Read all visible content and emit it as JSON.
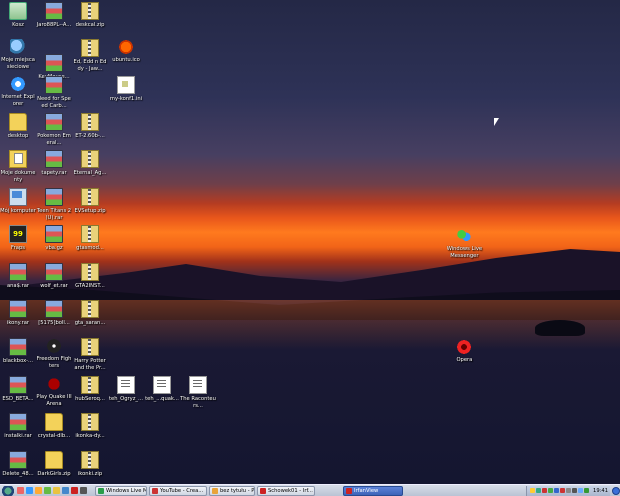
{
  "desktop": {
    "icons": [
      {
        "label": "Kosz",
        "type": "recycle"
      },
      {
        "label": "Moje miejsca sieciowe",
        "type": "network"
      },
      {
        "label": "Internet Explorer",
        "type": "ie"
      },
      {
        "label": "desktop",
        "type": "folder"
      },
      {
        "label": "Moje dokumenty",
        "type": "mydocs"
      },
      {
        "label": "Mój komputer",
        "type": "computer"
      },
      {
        "label": "Fraps",
        "type": "fraps"
      },
      {
        "label": "ana$.rar",
        "type": "rar"
      },
      {
        "label": "ikony.rar",
        "type": "rar"
      },
      {
        "label": "blackbox-...",
        "type": "rar"
      },
      {
        "label": "ESD_BETA...",
        "type": "rar"
      },
      {
        "label": "instalki.rar",
        "type": "rar"
      },
      {
        "label": "Delete_48...",
        "type": "rar"
      },
      {
        "label": "Jaro88PL--A...",
        "type": "rar"
      },
      {
        "label": "KeyMouse...",
        "type": "rar"
      },
      {
        "label": "Need for Speed Carb...",
        "type": "rar"
      },
      {
        "label": "Pokemon Emeral...",
        "type": "rar"
      },
      {
        "label": "tapety.rar",
        "type": "rar"
      },
      {
        "label": "Teen Titans 2 (U).rar",
        "type": "rar"
      },
      {
        "label": "vba.gz",
        "type": "rar"
      },
      {
        "label": "wolf_et.rar",
        "type": "rar"
      },
      {
        "label": "[5175]boll...",
        "type": "rar"
      },
      {
        "label": "Freedom Fighters",
        "type": "game"
      },
      {
        "label": "Play Quake III Arena",
        "type": "quake"
      },
      {
        "label": "crystal-dlb...",
        "type": "folder"
      },
      {
        "label": "DarkGirls.zip",
        "type": "folder"
      },
      {
        "label": "deskcal.zip",
        "type": "zip"
      },
      {
        "label": "Ed, Edd n Eddy - Jaw...",
        "type": "zip"
      },
      {
        "label": "ET-2.60b-...",
        "type": "zip"
      },
      {
        "label": "Eternal_Ag...",
        "type": "zip"
      },
      {
        "label": "EVSetup.zip",
        "type": "zip"
      },
      {
        "label": "gtasmod...",
        "type": "zip"
      },
      {
        "label": "GTA2INST...",
        "type": "zip"
      },
      {
        "label": "gta_saran...",
        "type": "zip"
      },
      {
        "label": "Harry Potter and the Pr...",
        "type": "zip"
      },
      {
        "label": "hubSeroq...",
        "type": "zip"
      },
      {
        "label": "ikonka-dy...",
        "type": "zip"
      },
      {
        "label": "ikonki.zip",
        "type": "zip"
      },
      {
        "label": "ubuntu.ico",
        "type": "ico"
      },
      {
        "label": "my-konf1.ini",
        "type": "ini"
      },
      {
        "label": "teh_Ogryz_...",
        "type": "doc"
      },
      {
        "label": "teh_...quak...",
        "type": "doc"
      },
      {
        "label": "The Raconteurs...",
        "type": "doc"
      },
      {
        "label": "Windows Live Messenger",
        "type": "messenger"
      },
      {
        "label": "Opera",
        "type": "opera"
      }
    ]
  },
  "taskbar": {
    "tasks": [
      {
        "label": "Windows Live M...",
        "color": "#2a9d4a",
        "active": false
      },
      {
        "label": "YouTube - Crea...",
        "color": "#c33",
        "active": false
      },
      {
        "label": "bez tytułu - Paint",
        "color": "#e8a33a",
        "active": false
      },
      {
        "label": "Schowek01 - Irf...",
        "color": "#c22",
        "active": false
      },
      {
        "label": "IrfanView",
        "color": "#c22",
        "active": true
      }
    ],
    "clock": "19:41"
  }
}
